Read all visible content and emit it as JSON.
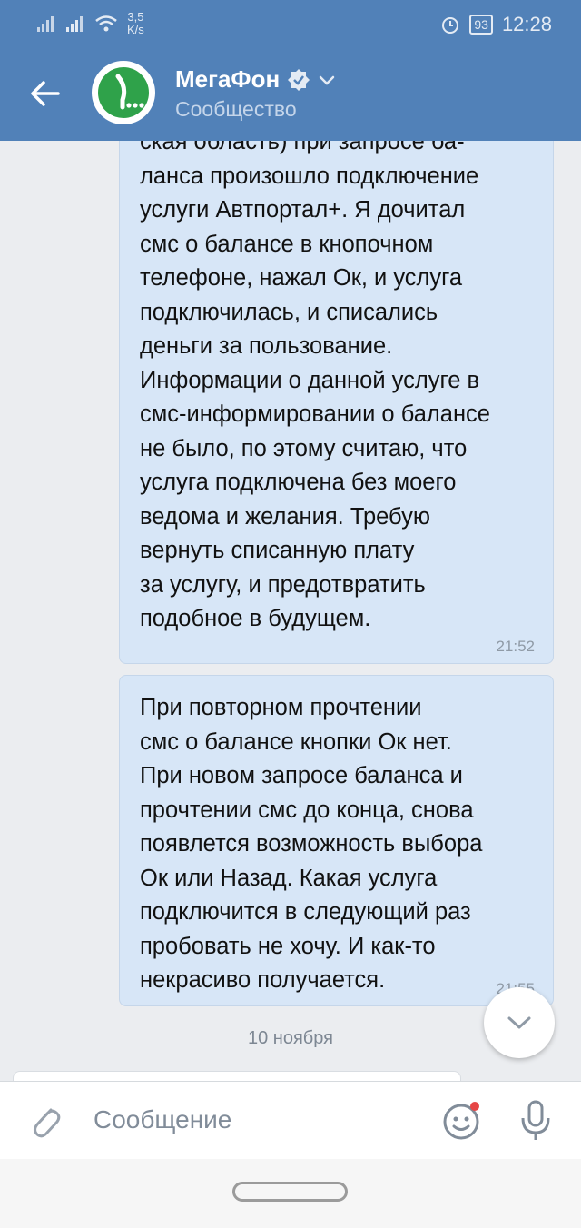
{
  "status_bar": {
    "speed_value": "3,5",
    "speed_unit": "K/s",
    "battery": "93",
    "time": "12:28"
  },
  "header": {
    "back_icon": "arrow-left-icon",
    "title": "МегаФон",
    "subtitle": "Сообщество",
    "verified_icon": "verified-check-icon",
    "dropdown_icon": "chevron-down-icon",
    "avatar_icon": "megafon-logo"
  },
  "messages": [
    {
      "lines": [
        "ская область) при запросе ба-",
        "ланса произошло подключение",
        "услуги Автпортал+. Я дочитал",
        "смс о балансе в кнопочном",
        "телефоне, нажал Ок, и услуга",
        "подключилась, и списались",
        "деньги за пользование.",
        "Информации о данной услуге в",
        "смс-информировании о балансе",
        "не было, по этому считаю, что",
        "услуга подключена без моего",
        "ведома и желания. Требую",
        "вернуть списанную плату",
        "за услугу, и предотвратить",
        "подобное в будущем."
      ],
      "time": "21:52"
    },
    {
      "lines": [
        "При повторном прочтении",
        "смс о балансе кнопки Ок нет.",
        "При новом запросе баланса и",
        "прочтении смс до конца, снова",
        "появлется возможность выбора",
        "Ок или Назад. Какая услуга",
        "подключится в следующий раз",
        "пробовать не хочу. И как-то",
        "некрасиво получается."
      ],
      "time": "21:55"
    }
  ],
  "date_separator": "10 ноября",
  "composer": {
    "placeholder": "Сообщение",
    "attach_icon": "paperclip-icon",
    "emoji_icon": "smiley-icon",
    "mic_icon": "microphone-icon"
  },
  "colors": {
    "header": "#5181b8",
    "bubble": "#d7e6f7",
    "background": "#ebedf0",
    "brand_green": "#2fa24a"
  }
}
